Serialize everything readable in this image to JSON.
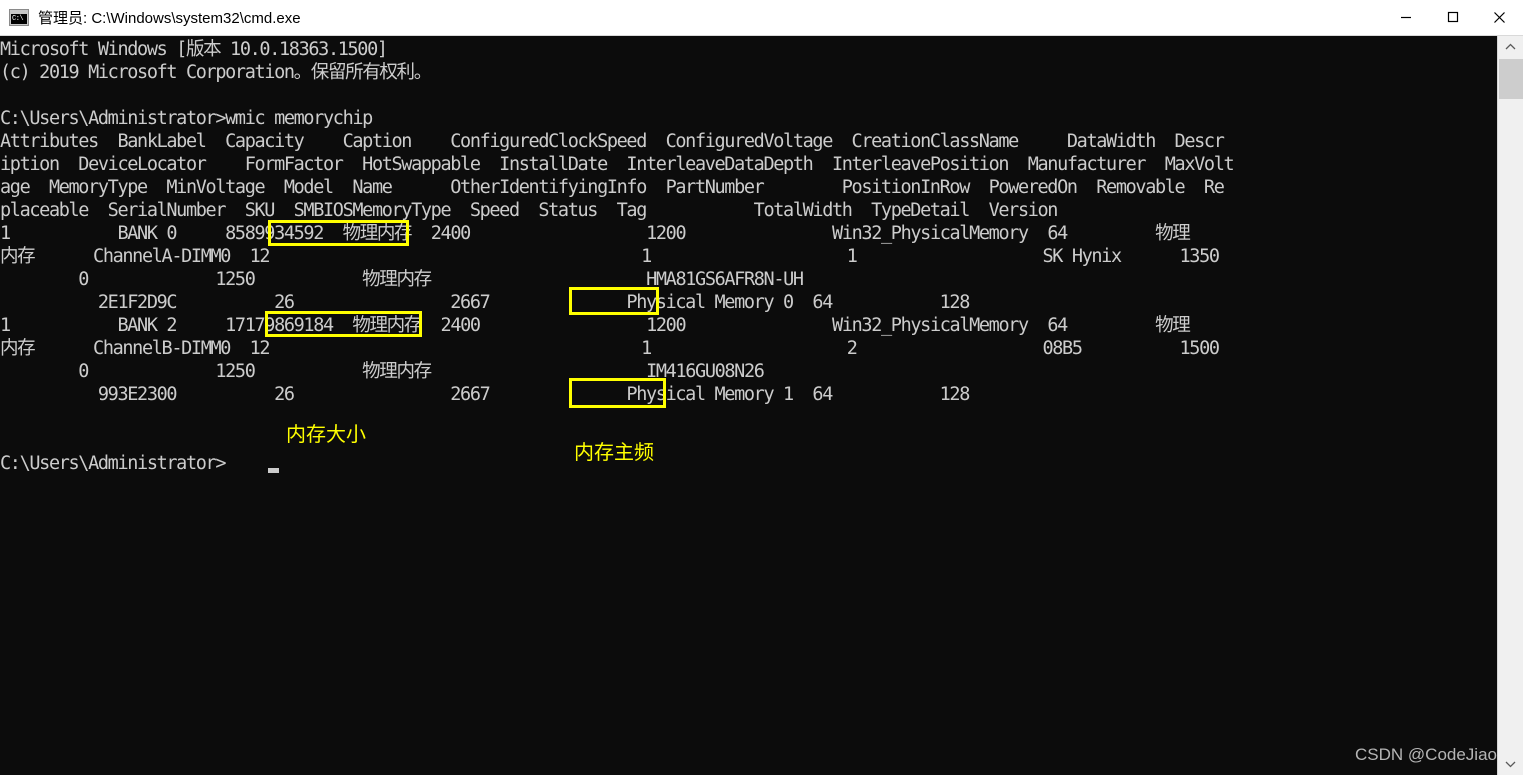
{
  "window": {
    "title": "管理员: C:\\Windows\\system32\\cmd.exe",
    "icon": "console-icon",
    "controls": {
      "minimize": "minimize-icon",
      "maximize": "maximize-icon",
      "close": "close-icon"
    }
  },
  "terminal": {
    "lines": [
      "Microsoft Windows [版本 10.0.18363.1500]",
      "(c) 2019 Microsoft Corporation。保留所有权利。",
      "",
      "C:\\Users\\Administrator>wmic memorychip",
      "Attributes  BankLabel  Capacity    Caption    ConfiguredClockSpeed  ConfiguredVoltage  CreationClassName     DataWidth  Descr",
      "iption  DeviceLocator    FormFactor  HotSwappable  InstallDate  InterleaveDataDepth  InterleavePosition  Manufacturer  MaxVolt",
      "age  MemoryType  MinVoltage  Model  Name      OtherIdentifyingInfo  PartNumber        PositionInRow  PoweredOn  Removable  Re",
      "placeable  SerialNumber  SKU  SMBIOSMemoryType  Speed  Status  Tag           TotalWidth  TypeDetail  Version",
      "1           BANK 0     8589934592  物理内存  2400                  1200               Win32_PhysicalMemory  64         物理",
      "内存      ChannelA-DIMM0  12                                      1                    1                   SK Hynix      1350",
      "        0             1250           物理内存                      HMA81GS6AFR8N-UH",
      "          2E1F2D9C          26                2667              Physical Memory 0  64           128",
      "1           BANK 2     17179869184  物理内存  2400                 1200               Win32_PhysicalMemory  64         物理",
      "内存      ChannelB-DIMM0  12                                      1                    2                   08B5          1500",
      "        0             1250           物理内存                      IM416GU08N26",
      "          993E2300          26                2667              Physical Memory 1  64           128",
      "",
      "",
      "C:\\Users\\Administrator>"
    ],
    "prompt": "C:\\Users\\Administrator>",
    "command": "wmic memorychip",
    "cursor": "block-cursor"
  },
  "wmic_output": {
    "columns": [
      "Attributes",
      "BankLabel",
      "Capacity",
      "Caption",
      "ConfiguredClockSpeed",
      "ConfiguredVoltage",
      "CreationClassName",
      "DataWidth",
      "Description",
      "DeviceLocator",
      "FormFactor",
      "HotSwappable",
      "InstallDate",
      "InterleaveDataDepth",
      "InterleavePosition",
      "Manufacturer",
      "MaxVoltage",
      "MemoryType",
      "MinVoltage",
      "Model",
      "Name",
      "OtherIdentifyingInfo",
      "PartNumber",
      "PositionInRow",
      "PoweredOn",
      "Removable",
      "Replaceable",
      "SerialNumber",
      "SKU",
      "SMBIOSMemoryType",
      "Speed",
      "Status",
      "Tag",
      "TotalWidth",
      "TypeDetail",
      "Version"
    ],
    "records": [
      {
        "Attributes": "1",
        "BankLabel": "BANK 0",
        "Capacity": "8589934592",
        "Caption": "物理内存",
        "ConfiguredClockSpeed": "2400",
        "ConfiguredVoltage": "1200",
        "CreationClassName": "Win32_PhysicalMemory",
        "DataWidth": "64",
        "Description": "物理内存",
        "DeviceLocator": "ChannelA-DIMM0",
        "FormFactor": "12",
        "InterleaveDataDepth": "1",
        "InterleavePosition": "1",
        "Manufacturer": "SK Hynix",
        "MaxVoltage": "1350",
        "MinVoltage": "1250",
        "Name": "物理内存",
        "PartNumber": "HMA81GS6AFR8N-UH",
        "PositionInRow": "0",
        "SerialNumber": "2E1F2D9C",
        "SMBIOSMemoryType": "26",
        "Speed": "2667",
        "Tag": "Physical Memory 0",
        "TotalWidth": "64",
        "TypeDetail": "128"
      },
      {
        "Attributes": "1",
        "BankLabel": "BANK 2",
        "Capacity": "17179869184",
        "Caption": "物理内存",
        "ConfiguredClockSpeed": "2400",
        "ConfiguredVoltage": "1200",
        "CreationClassName": "Win32_PhysicalMemory",
        "DataWidth": "64",
        "Description": "物理内存",
        "DeviceLocator": "ChannelB-DIMM0",
        "FormFactor": "12",
        "InterleaveDataDepth": "1",
        "InterleavePosition": "2",
        "Manufacturer": "08B5",
        "MaxVoltage": "1500",
        "MinVoltage": "1250",
        "Name": "物理内存",
        "PartNumber": "IM416GU08N26",
        "PositionInRow": "0",
        "SerialNumber": "993E2300",
        "SMBIOSMemoryType": "26",
        "Speed": "2667",
        "Tag": "Physical Memory 1",
        "TotalWidth": "64",
        "TypeDetail": "128"
      }
    ]
  },
  "annotations": {
    "color": "#ffff00",
    "capacity_label": "内存大小",
    "speed_label": "内存主频",
    "highlights": [
      {
        "value": "8589934592",
        "field": "Capacity"
      },
      {
        "value": "17179869184",
        "field": "Capacity"
      },
      {
        "value": "2667",
        "field": "Speed"
      },
      {
        "value": "2667",
        "field": "Speed"
      }
    ]
  },
  "watermark": {
    "text": "CSDN @CodeJiao"
  },
  "scrollbar": {
    "up_arrow": "chevron-up-icon",
    "down_arrow": "chevron-down-icon"
  }
}
